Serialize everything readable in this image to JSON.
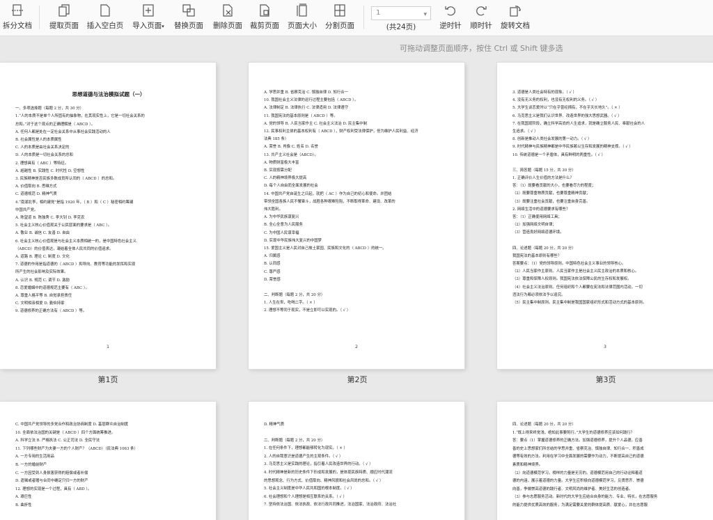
{
  "toolbar": {
    "split_doc": "拆分文档",
    "extract_page": "提取页面",
    "insert_blank": "插入空白页",
    "import_page": "导入页面",
    "import_arrow": "▾",
    "replace_page": "替换页面",
    "delete_page": "删除页面",
    "crop_page": "裁剪页面",
    "page_size": "页面大小",
    "split_page": "分割页面",
    "page_value": "1",
    "page_total": "(共24页)",
    "rotate_ccw": "逆时针",
    "rotate_cw": "顺时针",
    "rotate_doc": "旋转文档"
  },
  "hint": "可拖动调整页面顺序，按住 Ctrl 或 Shift 键多选",
  "pages": [
    {
      "caption": "第1页",
      "num": "1",
      "title": "思想道德与法治模拟试题（一）",
      "lines": [
        "一、多项选择题（每题 2 分，共 30 分）",
        "1.“人的本质不是单个人所固有的抽象物，在其现实性上，它是一切社会关系的",
        "总和。”对于这个观点的正确理解是（    ABCD    ）。",
        "A. 任何人都是处在一定社会关系中从事社会实践活动的人",
        "B. 社会属性是人的本质属性",
        "C. 人的本质是由社会关系决定的",
        "D. 人的本质是一切社会关系的总和",
        "2. 理想具有（  ABC  ）等特征。",
        "A. 超越性        B. 实践性      C. 时代性      D. 空想性",
        "3. 民族精神是否民族多数成员所认同的（  ABCD  ）的总和。",
        "A. 价值取向              B. 思维方式",
        "C. 道德规范              D. 精神气质",
        "4.“南湖北李，相约建党”是指 1920 年，（  B  ）和（  C  ）秘密相约筹建",
        "中国共产党。",
        "A. 陈望道         B. 陈独秀          C. 李大钊         D. 李克农",
        "5. 社会主义核心价值观关于公民层面的要求是（  ABC  ）。",
        "A. 敬业        B. 诚信        C. 友善        D. 自由",
        "6. 社会主义核心价值观是与社会主义本质相统一的，是中国特色社会主义",
        "（ABCD）的价值表达，凝结着全体人民共同的价值追求。",
        "A. 道路          B. 理论          C. 制度          D. 文化",
        "7. 道德的作用是指道德的（     ABCD     ）和导向、教育等功能的发挥和实现",
        "所产生的社会影响及实际效果。",
        "A. 认识          B. 规范          C. 调节          D. 激励",
        "8. 恋爱婚姻中的道德规范主要有（    ABC    ）。",
        "A. 尊重人格平等     B. 自觉承担责任",
        "C. 文明相亲相爱     D. 勤俭持家",
        "9. 道德修养的正确方法有（    ABCD    ）等。"
      ]
    },
    {
      "caption": "第2页",
      "num": "2",
      "lines": [
        "A. 学思并重       B. 省察克治       C. 慎独自律       D. 知行合一",
        "10. 我国社会主义法律的运行过程主要包括（     ABCD     ）。",
        "A. 法律制定       B. 法律执行       C. 法律适用       D. 法律遵守",
        "11. 我国宪法的基本原则是（     ABCD     ）等。",
        "A. 党的领导       B. 人民当家作主       C. 社会主义法治       D. 民主集中制",
        "12. 民事权利主体的基本权利有（   ABCD   ），财产权利受法律保护，但为维护人民利益、经济",
        "法典 185 条）",
        "A. 荣誉            B. 肖像            C. 姓名            D. 名誉",
        "13. 共产主义社会是（ABCD）。",
        "A. 物质财富极大丰富",
        "B. 实现按需分配",
        "C. 人的精神境界极大提高",
        "D. 每个人自由而全面发展的社会",
        "14. 中国共产党自诞生之日起，就把（   AC   ）作为自己的初心和使命。并团结",
        "带领全国各族人民不懈奋斗，战胜各种艰难险阻，不断取得革命、建设、改革的",
        "伟大胜利。",
        "A. 为中华民族谋复兴",
        "B. 全心全意为人民服务",
        "C. 为中国人民谋幸福",
        "D. 实现中华民族伟大复兴的中国梦",
        "15. 爱国主义是人民对自己故土家园、民族和文化的（  ABCD  ）的统一。",
        "A. 归属感",
        "B. 认同感",
        "C. 尊严感",
        "D. 荣誉感",
        "",
        "二、判断题（每题 2 分，共 20 分）",
        "1. 人生在世，吃喝二字。（ × ）",
        "2. 理想不等同于现实，不是立即可以实现的。（ √ ）"
      ]
    },
    {
      "caption": "第3页",
      "num": "3",
      "lines": [
        "3. 道德是人类社会特有的现象。（ √ ）",
        "4. 没有无义务的权利，也没有无权利的义务。（ √ ）",
        "5. 大学生谈恋爱时以“只在乎曾经拥有，不在乎天长地久”。（ × ）",
        "6. 马克思主义是我们认识世界、改造世界的强大思想武器。（ √ ）",
        "7. 在我国现阶段，确立科学高尚的人生追求，就是确立服务人民、奉献社会的人",
        "生追求。（ √ ）",
        "8. 创新是推动人类社会发展的第一动力。（ √ ）",
        "9. 时代精神与民族精神都是中华民族赖以生存和发展的精神支撑。（ √ ）",
        "10. 传统道德是一个矛盾体，具有鲜明的两重性。（ √ ）",
        "",
        "三、简答题（每题 15 分，共 30 分）",
        "1. 正确评价人生价值的方法是什么？",
        "答：（1）既要看贡献的大小，也要看尽力的程度；",
        "（2）既要尊重物质贡献，也要尊重精神贡献；",
        "（3）既要注重社会贡献，也要注重自身完善。",
        "2. 网络生活中的道德要求有哪些？",
        "答：（1）正确使用网络工具；",
        "（2）加强网络文明自律；",
        "（3）营造良好网络道德环境。",
        "",
        "四、论述题（每题 20 分，共 20 分）",
        "我国宪法的基本原则有哪些？",
        "答案要点：（1）党的领导原则。中国特色社会主义事业的领导核心。",
        "（2）人民当家作主原则。人民当家作主是社会主义民主政治的本质和核心。",
        "（3）尊重和保障人权原则。我国宪法依法保障公民的生存权和发展权。",
        "（4）社会主义法治原则。任何组织和个人都要在宪法和法律范围内活动，一切",
        "违法行为都必须依法予以追究。",
        "（5）民主集中制原则。民主集中制是我国国家组织形式和活动方式的基本原则。"
      ]
    },
    {
      "lines": [
        "",
        "C. 中国共产党领导的多党合作和政治协商制度    D. 基层群众自治制度",
        "10. 全面依法治国的关键是（  ABCD  ）四个方面统筹推进。",
        "A. 科学立法      B. 严格执法      C. 公正司法      D. 全民守法",
        "11. 下列哪些财产为夫妻一方的个人财产？（ABCD）（民法典 1063 条）",
        "A. 一方专用的生活用品",
        "B. 一方的婚前财产",
        "C. 一方因受到人身损害获得的赔偿或者补偿",
        "D. 遗嘱或者赠与合同中确定只归一方的财产",
        "12. 理想的实现是一个过程，具有（    ABD    ）。",
        "A. 艰巨性",
        "B. 曲折性"
      ]
    },
    {
      "lines": [
        "D. 精神气质",
        "",
        "二、判断题（每题 2 分，共 20 分）",
        "1. 在任何条件下，理想都能够转化为现实。（ × ）",
        "2. 人的自我意识是道德产生的主观条件。（ √ ）",
        "3. 马克思主义是实践的理论，指引着人民改造世界的行动。（ √ ）",
        "4. 时代精神是新的历史条件下形成和发展的，是体现民族特质、顺应时代潮流",
        "的思想观念、行为方式、价值取向、精神风貌和社会风尚的总和。（ √ ）",
        "5. 社会主义制度是中华人民共和国的根本制度。（ √ ）",
        "6. 社会理想和个人理想是相互联系的关系。（ √ ）",
        "7. 坚持依法治国、依法执政、依法行政共同推进，法治国家、法治政府、法治社"
      ]
    },
    {
      "lines": [
        "四、论述题（每题 20 分，共 20 分）",
        "1.“既上得来终觉浅，绝知此事要躬行。”大学生的道德修养应该如何践行？",
        "答：要点（1）掌握道德修养的正确方法。加强道德修养，提升个人品德，应善",
        "善的史上思想家们所总结的学思并重、省察克治、慎独自律、知行合一、积善成",
        "德等有效的方法。利用在学习中全面发展的需要作为动力，不断提高自己的道德",
        "素质和精神境界。",
        "（2）向道德模范学习。榜样的力量是无穷的。道德模范用自己的行动诠释着道",
        "德的内涵，展示着道德的力量。大学生应积极向道德模范学习，见贤思齐、崇德",
        "向善，争做崇高道德的践行者、文明风尚的维护者、美好生活的创造者。",
        "（3）参与志愿服务活动。新时代的大学生应结合自身的能力、专业、特长，在志愿服务",
        "的能力提供优质高效的服务，为满足需要关爱的群体提高质、献爱心，并在志愿服"
      ]
    }
  ]
}
